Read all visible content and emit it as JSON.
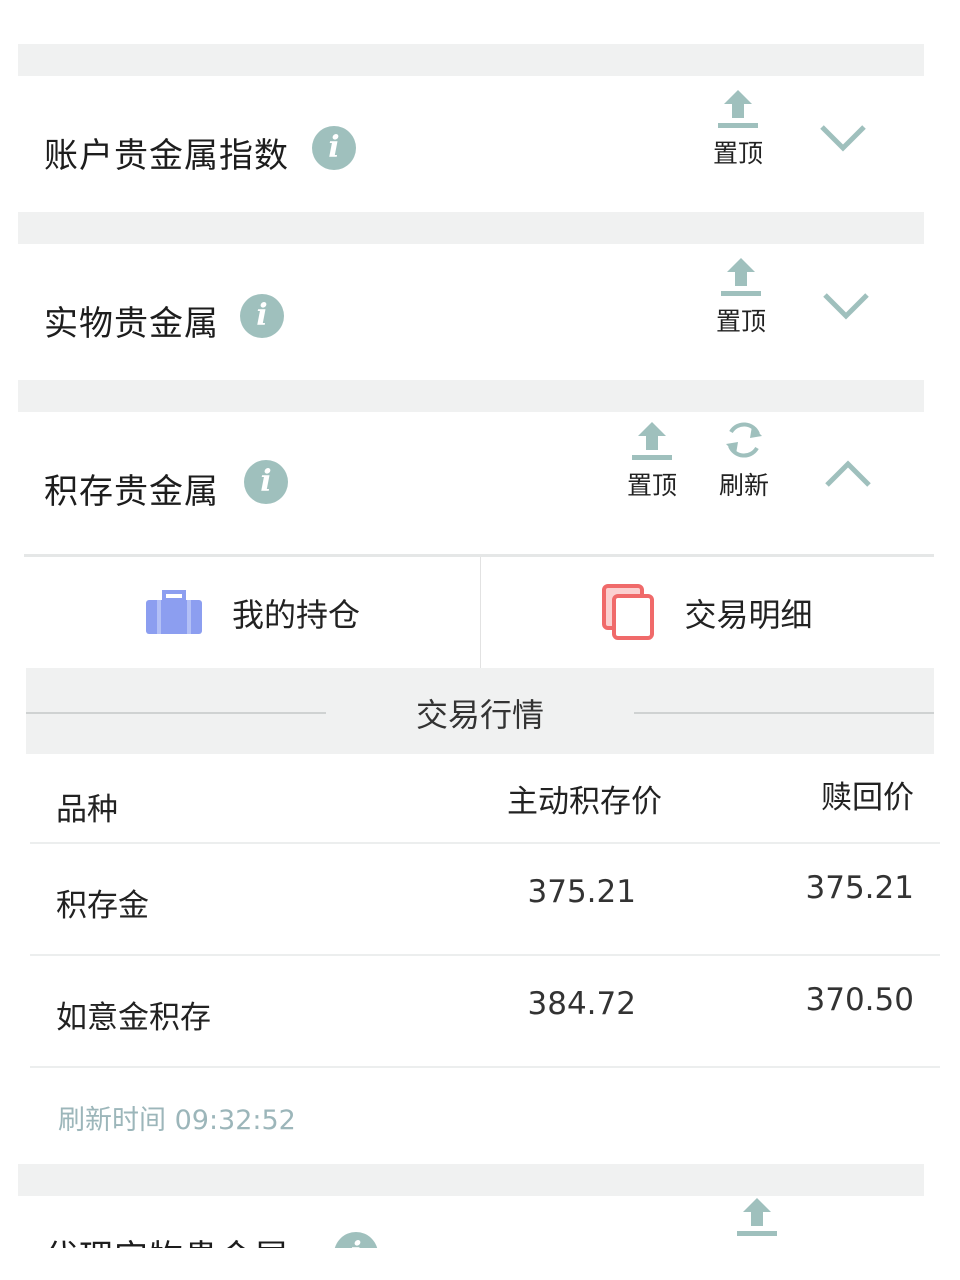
{
  "sections": [
    {
      "title": "账户贵金属指数",
      "pin_label": "置顶",
      "expanded": false
    },
    {
      "title": "实物贵金属",
      "pin_label": "置顶",
      "expanded": false
    },
    {
      "title": "积存贵金属",
      "pin_label": "置顶",
      "refresh_label": "刷新",
      "expanded": true
    },
    {
      "title": "代理实物贵金属",
      "expanded": false
    }
  ],
  "info_icon": "info-icon",
  "tabs": [
    {
      "label": "我的持仓",
      "icon": "briefcase-icon",
      "color": "#8c9ef0"
    },
    {
      "label": "交易明细",
      "icon": "copy-icon",
      "color": "#f06a6a"
    }
  ],
  "market": {
    "title": "交易行情",
    "columns": [
      "品种",
      "主动积存价",
      "赎回价"
    ],
    "rows": [
      {
        "name": "积存金",
        "buy": "375.21",
        "redeem": "375.21"
      },
      {
        "name": "如意金积存",
        "buy": "384.72",
        "redeem": "370.50"
      }
    ],
    "refresh_time": "刷新时间 09:32:52"
  },
  "colors": {
    "accent": "#9fc0bd",
    "divider": "#eceeee",
    "muted_text": "#9cb6ba"
  }
}
